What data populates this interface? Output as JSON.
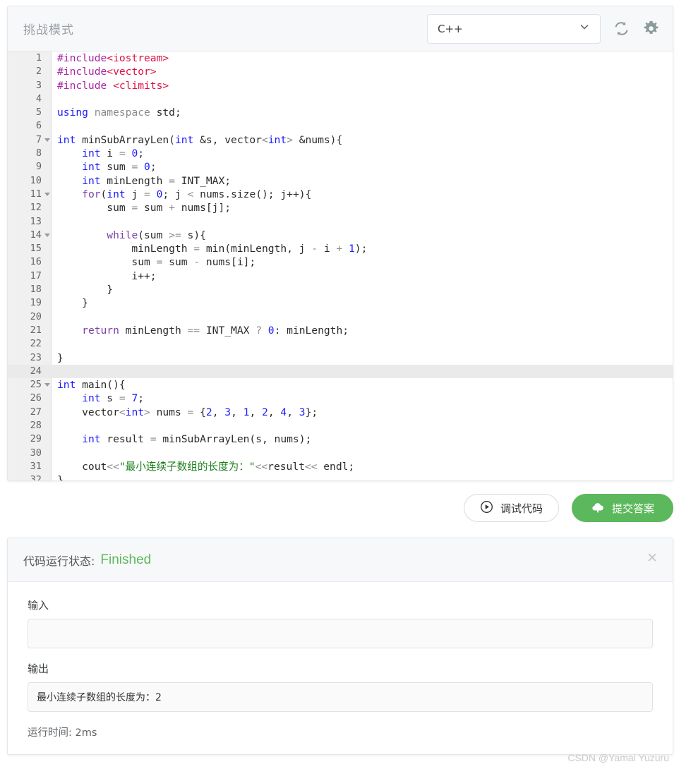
{
  "editor": {
    "mode_title": "挑战模式",
    "language": "C++",
    "refresh_icon": "refresh-icon",
    "settings_icon": "gear-icon",
    "chevron_icon": "chevron-down-icon",
    "active_line": 24,
    "lines": [
      {
        "n": 1,
        "fold": false,
        "tokens": [
          {
            "t": "pre",
            "s": "#include"
          },
          {
            "t": "inc",
            "s": "<iostream>"
          }
        ]
      },
      {
        "n": 2,
        "fold": false,
        "tokens": [
          {
            "t": "pre",
            "s": "#include"
          },
          {
            "t": "inc",
            "s": "<vector>"
          }
        ]
      },
      {
        "n": 3,
        "fold": false,
        "tokens": [
          {
            "t": "pre",
            "s": "#include"
          },
          {
            "t": "txt",
            "s": " "
          },
          {
            "t": "inc",
            "s": "<climits>"
          }
        ]
      },
      {
        "n": 4,
        "fold": false,
        "tokens": []
      },
      {
        "n": 5,
        "fold": false,
        "tokens": [
          {
            "t": "kw",
            "s": "using"
          },
          {
            "t": "txt",
            "s": " "
          },
          {
            "t": "ns",
            "s": "namespace"
          },
          {
            "t": "txt",
            "s": " std;"
          }
        ]
      },
      {
        "n": 6,
        "fold": false,
        "tokens": []
      },
      {
        "n": 7,
        "fold": true,
        "tokens": [
          {
            "t": "typ",
            "s": "int"
          },
          {
            "t": "txt",
            "s": " minSubArrayLen("
          },
          {
            "t": "typ",
            "s": "int"
          },
          {
            "t": "txt",
            "s": " &s, vector"
          },
          {
            "t": "op",
            "s": "<"
          },
          {
            "t": "typ",
            "s": "int"
          },
          {
            "t": "op",
            "s": ">"
          },
          {
            "t": "txt",
            "s": " &nums){"
          }
        ]
      },
      {
        "n": 8,
        "fold": false,
        "tokens": [
          {
            "t": "txt",
            "s": "    "
          },
          {
            "t": "typ",
            "s": "int"
          },
          {
            "t": "txt",
            "s": " i "
          },
          {
            "t": "op",
            "s": "="
          },
          {
            "t": "txt",
            "s": " "
          },
          {
            "t": "num",
            "s": "0"
          },
          {
            "t": "txt",
            "s": ";"
          }
        ]
      },
      {
        "n": 9,
        "fold": false,
        "tokens": [
          {
            "t": "txt",
            "s": "    "
          },
          {
            "t": "typ",
            "s": "int"
          },
          {
            "t": "txt",
            "s": " sum "
          },
          {
            "t": "op",
            "s": "="
          },
          {
            "t": "txt",
            "s": " "
          },
          {
            "t": "num",
            "s": "0"
          },
          {
            "t": "txt",
            "s": ";"
          }
        ]
      },
      {
        "n": 10,
        "fold": false,
        "tokens": [
          {
            "t": "txt",
            "s": "    "
          },
          {
            "t": "typ",
            "s": "int"
          },
          {
            "t": "txt",
            "s": " minLength "
          },
          {
            "t": "op",
            "s": "="
          },
          {
            "t": "txt",
            "s": " INT_MAX;"
          }
        ]
      },
      {
        "n": 11,
        "fold": true,
        "tokens": [
          {
            "t": "txt",
            "s": "    "
          },
          {
            "t": "ctl",
            "s": "for"
          },
          {
            "t": "txt",
            "s": "("
          },
          {
            "t": "typ",
            "s": "int"
          },
          {
            "t": "txt",
            "s": " j "
          },
          {
            "t": "op",
            "s": "="
          },
          {
            "t": "txt",
            "s": " "
          },
          {
            "t": "num",
            "s": "0"
          },
          {
            "t": "txt",
            "s": "; j "
          },
          {
            "t": "op",
            "s": "<"
          },
          {
            "t": "txt",
            "s": " nums.size(); j++){"
          }
        ]
      },
      {
        "n": 12,
        "fold": false,
        "tokens": [
          {
            "t": "txt",
            "s": "        sum "
          },
          {
            "t": "op",
            "s": "="
          },
          {
            "t": "txt",
            "s": " sum "
          },
          {
            "t": "op",
            "s": "+"
          },
          {
            "t": "txt",
            "s": " nums[j];"
          }
        ]
      },
      {
        "n": 13,
        "fold": false,
        "tokens": []
      },
      {
        "n": 14,
        "fold": true,
        "tokens": [
          {
            "t": "txt",
            "s": "        "
          },
          {
            "t": "ctl",
            "s": "while"
          },
          {
            "t": "txt",
            "s": "(sum "
          },
          {
            "t": "op",
            "s": ">="
          },
          {
            "t": "txt",
            "s": " s){"
          }
        ]
      },
      {
        "n": 15,
        "fold": false,
        "tokens": [
          {
            "t": "txt",
            "s": "            minLength "
          },
          {
            "t": "op",
            "s": "="
          },
          {
            "t": "txt",
            "s": " min(minLength, j "
          },
          {
            "t": "op",
            "s": "-"
          },
          {
            "t": "txt",
            "s": " i "
          },
          {
            "t": "op",
            "s": "+"
          },
          {
            "t": "txt",
            "s": " "
          },
          {
            "t": "num",
            "s": "1"
          },
          {
            "t": "txt",
            "s": ");"
          }
        ]
      },
      {
        "n": 16,
        "fold": false,
        "tokens": [
          {
            "t": "txt",
            "s": "            sum "
          },
          {
            "t": "op",
            "s": "="
          },
          {
            "t": "txt",
            "s": " sum "
          },
          {
            "t": "op",
            "s": "-"
          },
          {
            "t": "txt",
            "s": " nums[i];"
          }
        ]
      },
      {
        "n": 17,
        "fold": false,
        "tokens": [
          {
            "t": "txt",
            "s": "            i++;"
          }
        ]
      },
      {
        "n": 18,
        "fold": false,
        "tokens": [
          {
            "t": "txt",
            "s": "        }"
          }
        ]
      },
      {
        "n": 19,
        "fold": false,
        "tokens": [
          {
            "t": "txt",
            "s": "    }"
          }
        ]
      },
      {
        "n": 20,
        "fold": false,
        "tokens": []
      },
      {
        "n": 21,
        "fold": false,
        "tokens": [
          {
            "t": "txt",
            "s": "    "
          },
          {
            "t": "kw2",
            "s": "return"
          },
          {
            "t": "txt",
            "s": " minLength "
          },
          {
            "t": "op",
            "s": "=="
          },
          {
            "t": "txt",
            "s": " INT_MAX "
          },
          {
            "t": "op",
            "s": "?"
          },
          {
            "t": "txt",
            "s": " "
          },
          {
            "t": "num",
            "s": "0"
          },
          {
            "t": "txt",
            "s": ": minLength;"
          }
        ]
      },
      {
        "n": 22,
        "fold": false,
        "tokens": []
      },
      {
        "n": 23,
        "fold": false,
        "tokens": [
          {
            "t": "txt",
            "s": "}"
          }
        ]
      },
      {
        "n": 24,
        "fold": false,
        "tokens": []
      },
      {
        "n": 25,
        "fold": true,
        "tokens": [
          {
            "t": "typ",
            "s": "int"
          },
          {
            "t": "txt",
            "s": " main(){"
          }
        ]
      },
      {
        "n": 26,
        "fold": false,
        "tokens": [
          {
            "t": "txt",
            "s": "    "
          },
          {
            "t": "typ",
            "s": "int"
          },
          {
            "t": "txt",
            "s": " s "
          },
          {
            "t": "op",
            "s": "="
          },
          {
            "t": "txt",
            "s": " "
          },
          {
            "t": "num",
            "s": "7"
          },
          {
            "t": "txt",
            "s": ";"
          }
        ]
      },
      {
        "n": 27,
        "fold": false,
        "tokens": [
          {
            "t": "txt",
            "s": "    vector"
          },
          {
            "t": "op",
            "s": "<"
          },
          {
            "t": "typ",
            "s": "int"
          },
          {
            "t": "op",
            "s": ">"
          },
          {
            "t": "txt",
            "s": " nums "
          },
          {
            "t": "op",
            "s": "="
          },
          {
            "t": "txt",
            "s": " {"
          },
          {
            "t": "num",
            "s": "2"
          },
          {
            "t": "txt",
            "s": ", "
          },
          {
            "t": "num",
            "s": "3"
          },
          {
            "t": "txt",
            "s": ", "
          },
          {
            "t": "num",
            "s": "1"
          },
          {
            "t": "txt",
            "s": ", "
          },
          {
            "t": "num",
            "s": "2"
          },
          {
            "t": "txt",
            "s": ", "
          },
          {
            "t": "num",
            "s": "4"
          },
          {
            "t": "txt",
            "s": ", "
          },
          {
            "t": "num",
            "s": "3"
          },
          {
            "t": "txt",
            "s": "};"
          }
        ]
      },
      {
        "n": 28,
        "fold": false,
        "tokens": []
      },
      {
        "n": 29,
        "fold": false,
        "tokens": [
          {
            "t": "txt",
            "s": "    "
          },
          {
            "t": "typ",
            "s": "int"
          },
          {
            "t": "txt",
            "s": " result "
          },
          {
            "t": "op",
            "s": "="
          },
          {
            "t": "txt",
            "s": " minSubArrayLen(s, nums);"
          }
        ]
      },
      {
        "n": 30,
        "fold": false,
        "tokens": []
      },
      {
        "n": 31,
        "fold": false,
        "tokens": [
          {
            "t": "txt",
            "s": "    cout"
          },
          {
            "t": "op",
            "s": "<<"
          },
          {
            "t": "str",
            "s": "\"最小连续子数组的长度为："
          },
          {
            "t": "str",
            "s": "\""
          },
          {
            "t": "op",
            "s": "<<"
          },
          {
            "t": "txt",
            "s": "result"
          },
          {
            "t": "op",
            "s": "<<"
          },
          {
            "t": "txt",
            "s": " endl;"
          }
        ]
      },
      {
        "n": 32,
        "fold": false,
        "tokens": [
          {
            "t": "txt",
            "s": "}"
          }
        ]
      }
    ]
  },
  "actions": {
    "debug_label": "调试代码",
    "debug_icon": "play-circle-icon",
    "submit_label": "提交答案",
    "submit_icon": "cloud-upload-icon"
  },
  "result": {
    "status_label": "代码运行状态:",
    "status_value": "Finished",
    "status_color": "#5cb85c",
    "close_icon": "close-icon",
    "input_label": "输入",
    "input_value": "",
    "output_label": "输出",
    "output_value": "最小连续子数组的长度为：2",
    "runtime_label": "运行时间:",
    "runtime_value": "2ms"
  },
  "watermark": "CSDN @Yamai Yuzuru"
}
